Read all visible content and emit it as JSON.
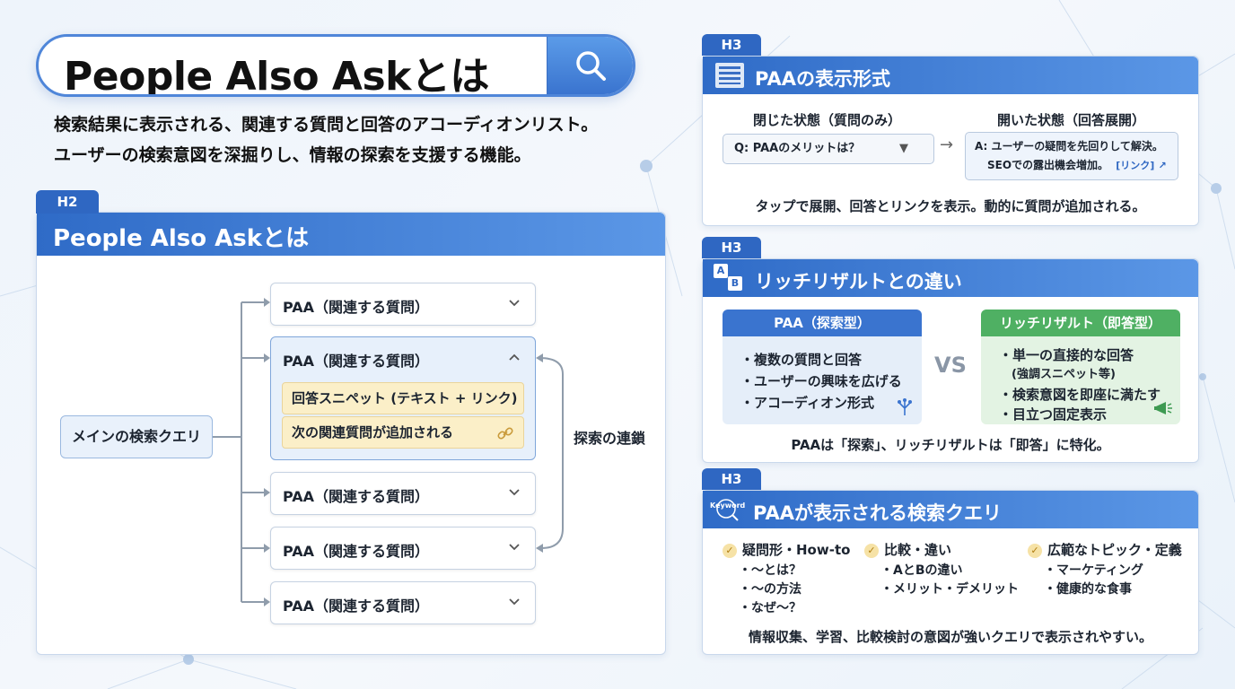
{
  "header": {
    "search_title": "People Also Askとは",
    "intro_line1": "検索結果に表示される、関連する質問と回答のアコーディオンリスト。",
    "intro_line2": "ユーザーの検索意図を深掘りし、情報の探索を支援する機能。"
  },
  "left_panel": {
    "tag": "H2",
    "title": "People Also Askとは",
    "main_query": "メインの検索クエリ",
    "paa_label": "PAA（関連する質問）",
    "answer_snippet": "回答スニペット (テキスト + リンク)",
    "next_question": "次の関連質問が追加される",
    "chain_label": "探索の連鎖"
  },
  "format_panel": {
    "tag": "H3",
    "title": "PAAの表示形式",
    "closed_title": "閉じた状態（質問のみ）",
    "open_title": "開いた状態（回答展開）",
    "closed_question": "Q: PAAのメリットは？",
    "open_answer_line1": "A: ユーザーの疑問を先回りして解決。",
    "open_answer_line2": "SEOでの露出機会増加。",
    "open_link": "[リンク]",
    "caption": "タップで展開、回答とリンクを表示。動的に質問が追加される。"
  },
  "rich_panel": {
    "tag": "H3",
    "title": "リッチリザルトとの違い",
    "icon_letters": [
      "A",
      "B"
    ],
    "paa_head": "PAA（探索型）",
    "paa_items": [
      "・複数の質問と回答",
      "・ユーザーの興味を広げる",
      "・アコーディオン形式"
    ],
    "vs": "VS",
    "rich_head": "リッチリザルト（即答型）",
    "rich_items": [
      "・単一の直接的な回答",
      "(強調スニペット等)",
      "・検索意図を即座に満たす",
      "・目立つ固定表示"
    ],
    "caption": "PAAは「探索」、リッチリザルトは「即答」に特化。"
  },
  "query_panel": {
    "tag": "H3",
    "title": "PAAが表示される検索クエリ",
    "icon_text": "Keyword",
    "columns": [
      {
        "head": "疑問形・How-to",
        "items": [
          "・〜とは？",
          "・〜の方法",
          "・なぜ〜？"
        ]
      },
      {
        "head": "比較・違い",
        "items": [
          "・AとBの違い",
          "・メリット・デメリット"
        ]
      },
      {
        "head": "広範なトピック・定義",
        "items": [
          "・マーケティング",
          "・健康的な食事"
        ]
      }
    ],
    "caption": "情報収集、学習、比較検討の意図が強いクエリで表示されやすい。"
  },
  "colors": {
    "primary_blue": "#2f67c2",
    "answer_yellow": "#fbefc8",
    "rich_green": "#4fb063"
  }
}
